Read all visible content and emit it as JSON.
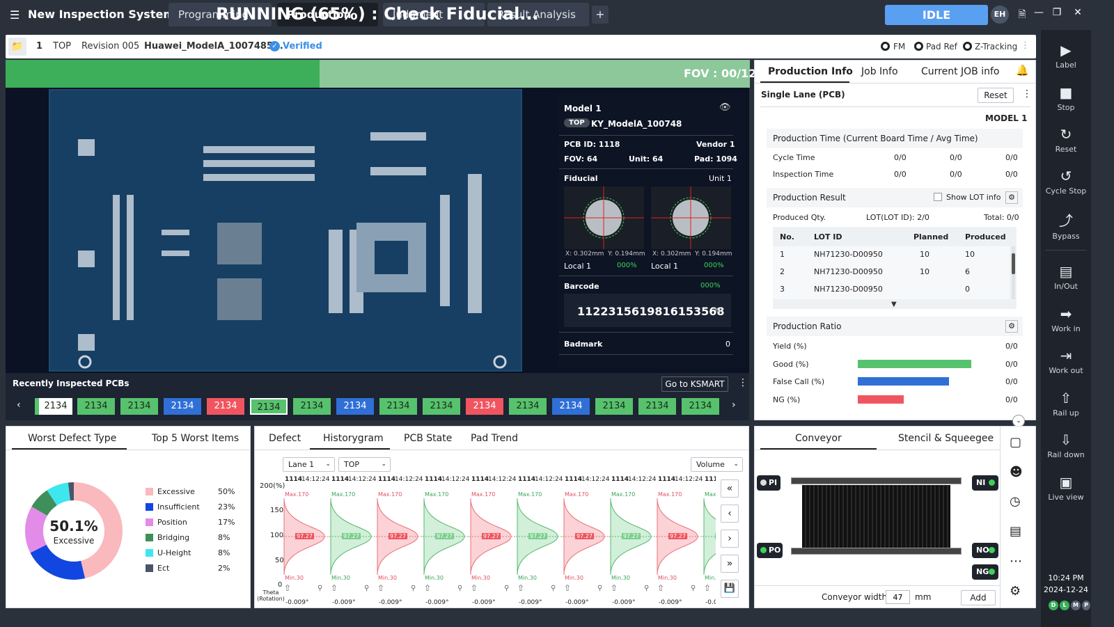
{
  "app": {
    "title": "New Inspection System",
    "status": "IDLE",
    "user_initials": "EH"
  },
  "tabs": [
    {
      "label": "Programming"
    },
    {
      "label": "Production"
    },
    {
      "label": "Judgment"
    },
    {
      "label": "Result Analysis"
    }
  ],
  "subbar": {
    "index": "1",
    "side": "TOP",
    "revision": "Revision 005",
    "model": "Huawei_ModelA_1007485...",
    "verified": "Verified",
    "options": [
      "FM",
      "Pad Ref",
      "Z-Tracking"
    ]
  },
  "run": {
    "status": "RUNNING (65%) : Check Fiducial...",
    "progress": 65,
    "fov": "FOV : 00/12"
  },
  "model_info": {
    "title": "Model 1",
    "side_badge": "TOP",
    "name": "KY_ModelA_100748",
    "pcb_id": "PCB ID: 1118",
    "vendor": "Vendor 1",
    "fov": "FOV: 64",
    "unit": "Unit: 64",
    "pad": "Pad: 1094",
    "fiducial_label": "Fiducial",
    "fiducial_unit": "Unit 1",
    "fid1": {
      "x": "X: 0.302mm",
      "y": "Y: 0.194mm",
      "local": "Local 1",
      "pct": "000%"
    },
    "fid2": {
      "x": "X: 0.302mm",
      "y": "Y: 0.194mm",
      "local": "Local 1",
      "pct": "000%"
    },
    "barcode_label": "Barcode",
    "barcode_pct": "000%",
    "barcode": "1122315619816153568",
    "badmark_label": "Badmark",
    "badmark_val": "0"
  },
  "recent": {
    "title": "Recently Inspected PCBs",
    "ksmart": "Go to KSMART",
    "chips": [
      "2134",
      "2134",
      "2134",
      "2134",
      "2134",
      "2134",
      "2134",
      "2134",
      "2134",
      "2134",
      "2134",
      "2134",
      "2134",
      "2134",
      "2134",
      "2134"
    ]
  },
  "prod_info": {
    "tabs": [
      "Production Info",
      "Job Info",
      "Current JOB info"
    ],
    "lane": "Single Lane (PCB)",
    "reset": "Reset",
    "model": "MODEL 1",
    "time_title": "Production Time (Current Board Time / Avg Time)",
    "cycle": {
      "label": "Cycle Time",
      "v": [
        "0/0",
        "0/0",
        "0/0"
      ]
    },
    "inspection": {
      "label": "Inspection Time",
      "v": [
        "0/0",
        "0/0",
        "0/0"
      ]
    },
    "result_title": "Production Result",
    "show_lot": "Show LOT info",
    "produced_qty": "Produced Qty.",
    "lot_summary": "LOT(LOT ID): 2/0",
    "total": "Total: 0/0",
    "table_headers": [
      "No.",
      "LOT ID",
      "Planned",
      "Produced"
    ],
    "rows": [
      [
        "1",
        "NH71230-D00950",
        "10",
        "10"
      ],
      [
        "2",
        "NH71230-D00950",
        "10",
        "6"
      ],
      [
        "3",
        "NH71230-D00950",
        "",
        "0"
      ]
    ],
    "ratio_title": "Production Ratio",
    "ratios": [
      {
        "label": "Yield (%)",
        "val": "0/0"
      },
      {
        "label": "Good (%)",
        "val": "0/0"
      },
      {
        "label": "False Call (%)",
        "val": "0/0"
      },
      {
        "label": "NG (%)",
        "val": "0/0"
      }
    ]
  },
  "defect": {
    "tabs": [
      "Worst Defect Type",
      "Top 5 Worst Items"
    ],
    "center_pct": "50.1%",
    "center_label": "Excessive",
    "items": [
      {
        "label": "Excessive",
        "pct": "50%",
        "color": "#f9b9bd"
      },
      {
        "label": "Insufficient",
        "pct": "23%",
        "color": "#1147e0"
      },
      {
        "label": "Position",
        "pct": "17%",
        "color": "#e38be8"
      },
      {
        "label": "Bridging",
        "pct": "8%",
        "color": "#3f8f5a"
      },
      {
        "label": "U-Height",
        "pct": "8%",
        "color": "#3ee6ee"
      },
      {
        "label": "Ect",
        "pct": "2%",
        "color": "#4b5468"
      }
    ]
  },
  "histo": {
    "tabs": [
      "Defect",
      "Historygram",
      "PCB State",
      "Pad Trend"
    ],
    "lane": "Lane 1",
    "side": "TOP",
    "mode": "Volume",
    "yticks": [
      "200(%)",
      "150",
      "100",
      "50",
      "0"
    ],
    "theta": "Theta (Rotation)",
    "id": "1114",
    "time": "14:12:24",
    "max": "Max.170",
    "min": "Min.30",
    "mid": "97.27",
    "angle": "-0.009°"
  },
  "conveyor": {
    "tabs": [
      "Conveyor",
      "Stencil & Squeegee"
    ],
    "pi": "PI",
    "po": "PO",
    "ni": "NI",
    "no": "NO",
    "ng": "NG",
    "width_label": "Conveyor width",
    "width_val": "47",
    "unit": "mm",
    "add": "Add"
  },
  "rightbar": [
    {
      "label": "Label",
      "icon": "play-icon"
    },
    {
      "label": "Stop",
      "icon": "stop-icon"
    },
    {
      "label": "Reset",
      "icon": "reset-icon"
    },
    {
      "label": "Cycle Stop",
      "icon": "cycle-stop-icon"
    },
    {
      "label": "Bypass",
      "icon": "bypass-icon"
    },
    {
      "label": "In/Out",
      "icon": "inout-icon"
    },
    {
      "label": "Work in",
      "icon": "work-in-icon"
    },
    {
      "label": "Work out",
      "icon": "work-out-icon"
    },
    {
      "label": "Rail up",
      "icon": "rail-up-icon"
    },
    {
      "label": "Rail down",
      "icon": "rail-down-icon"
    },
    {
      "label": "Live view",
      "icon": "live-view-icon"
    }
  ],
  "clock": {
    "time": "10:24 PM",
    "date": "2024-12-24"
  }
}
